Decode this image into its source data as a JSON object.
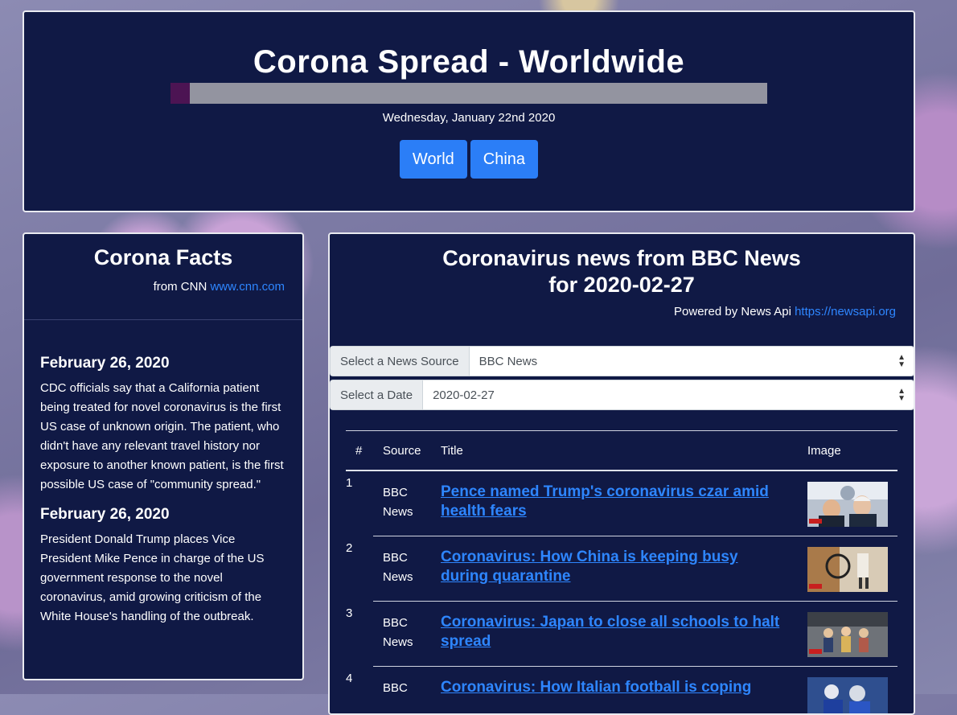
{
  "header": {
    "title": "Corona Spread - Worldwide",
    "progress_fraction": 0.033,
    "date": "Wednesday, January 22nd 2020",
    "buttons": [
      "World",
      "China"
    ]
  },
  "facts": {
    "title": "Corona Facts",
    "source_prefix": "from CNN",
    "source_link": "www.cnn.com",
    "items": [
      {
        "date": "February 26, 2020",
        "text": "CDC officials say that a California patient being treated for novel coronavirus is the first US case of unknown origin. The patient, who didn't have any relevant travel history nor exposure to another known patient, is the first possible US case of \"community spread.\""
      },
      {
        "date": "February 26, 2020",
        "text": "President Donald Trump places Vice President Mike Pence in charge of the US government response to the novel coronavirus, amid growing criticism of the White House's handling of the outbreak."
      }
    ]
  },
  "news": {
    "title_line1": "Coronavirus news from BBC News",
    "title_line2": "for 2020-02-27",
    "powered_prefix": "Powered by News Api",
    "powered_link": "https://newsapi.org",
    "source_label": "Select a News Source",
    "source_value": "BBC News",
    "date_label": "Select a Date",
    "date_value": "2020-02-27",
    "columns": [
      "#",
      "Source",
      "Title",
      "Image"
    ],
    "rows": [
      {
        "num": "1",
        "source": "BBC News",
        "title": "Pence named Trump's coronavirus czar amid health fears",
        "image": "pence-trump-photo"
      },
      {
        "num": "2",
        "source": "BBC News",
        "title": "Coronavirus: How China is keeping busy during quarantine",
        "image": "china-quarantine-photo"
      },
      {
        "num": "3",
        "source": "BBC News",
        "title": "Coronavirus: Japan to close all schools to halt spread",
        "image": "japan-schools-photo"
      },
      {
        "num": "4",
        "source": "BBC",
        "title": "Coronavirus: How Italian football is coping",
        "image": "italian-football-photo"
      }
    ]
  }
}
